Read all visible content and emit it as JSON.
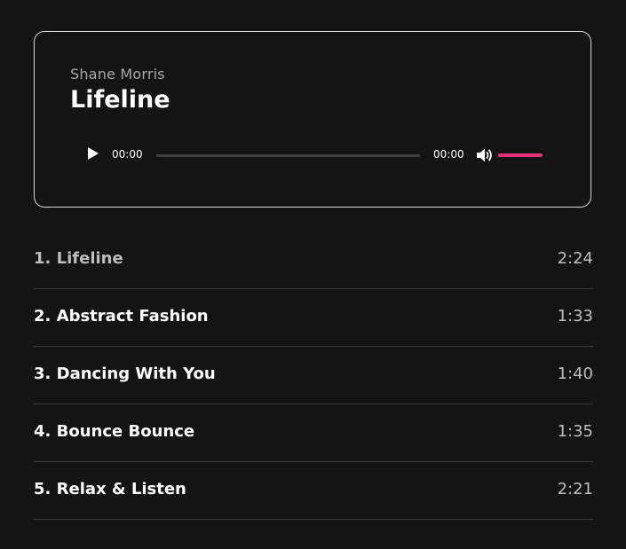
{
  "player": {
    "artist": "Shane Morris",
    "title": "Lifeline",
    "current_time": "00:00",
    "total_time": "00:00",
    "progress": 0,
    "volume": 1.0,
    "accent_color": "#e8317a",
    "play_icon": "play-icon",
    "volume_icon": "speaker-volume-icon"
  },
  "playlist": [
    {
      "number": "1.",
      "title": "Lifeline",
      "duration": "2:24",
      "active": true
    },
    {
      "number": "2.",
      "title": "Abstract Fashion",
      "duration": "1:33",
      "active": false
    },
    {
      "number": "3.",
      "title": "Dancing With You",
      "duration": "1:40",
      "active": false
    },
    {
      "number": "4.",
      "title": "Bounce Bounce",
      "duration": "1:35",
      "active": false
    },
    {
      "number": "5.",
      "title": "Relax & Listen",
      "duration": "2:21",
      "active": false
    }
  ]
}
